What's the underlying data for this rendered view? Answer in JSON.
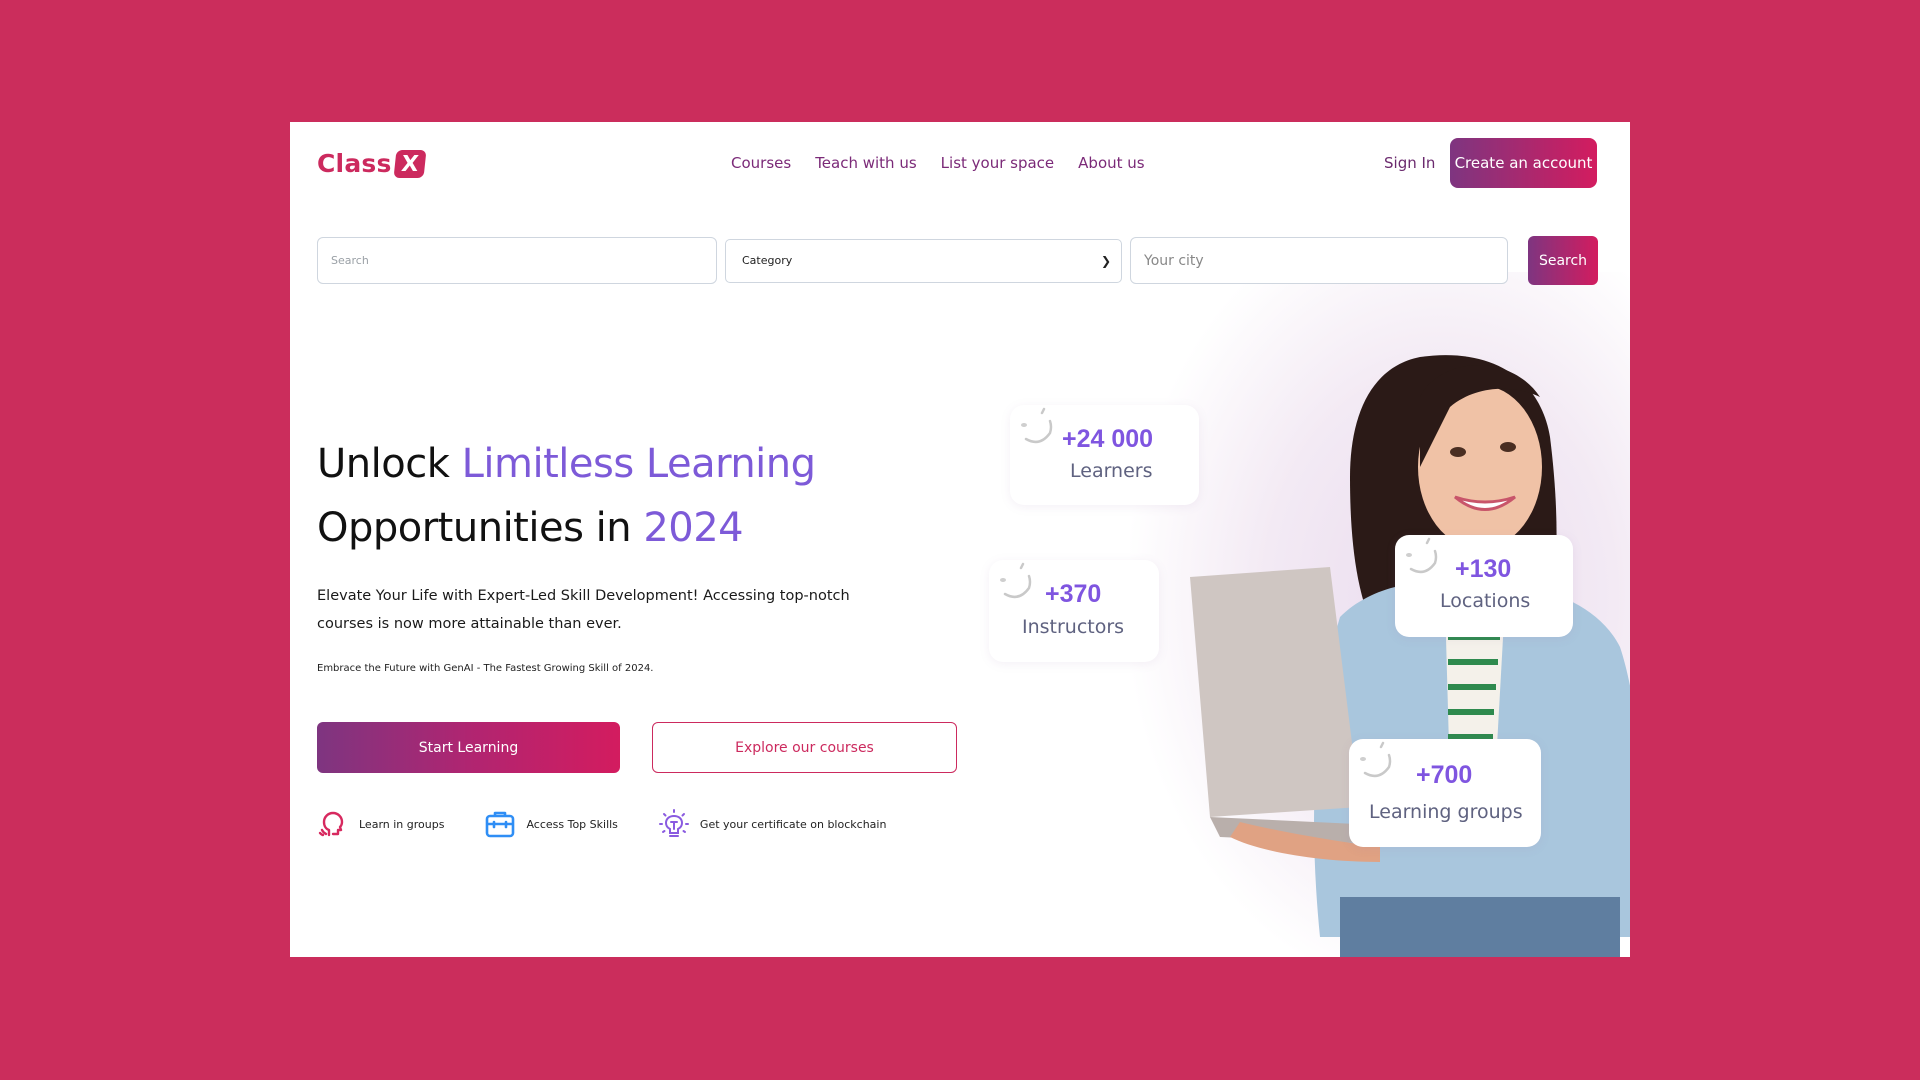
{
  "brand": {
    "name": "Class",
    "mark": "X",
    "color": "#cc2a5e"
  },
  "nav": {
    "items": [
      {
        "label": "Courses"
      },
      {
        "label": "Teach with us"
      },
      {
        "label": "List your space"
      },
      {
        "label": "About us"
      }
    ],
    "sign_in": "Sign In",
    "create_account": "Create an account"
  },
  "search": {
    "query_placeholder": "Search",
    "category_selected": "Category",
    "city_placeholder": "Your city",
    "button": "Search"
  },
  "hero": {
    "title_line1_plain": "Unlock ",
    "title_line1_accent": "Limitless Learning",
    "title_line2_plain": "Opportunities in ",
    "title_line2_accent": "2024",
    "description": "Elevate Your Life with Expert-Led Skill Development! Accessing top-notch courses is now more attainable than ever.",
    "tagline": "Embrace the Future with GenAI - The Fastest Growing Skill of 2024.",
    "primary_cta": "Start Learning",
    "secondary_cta": "Explore our courses",
    "features": [
      {
        "icon": "head-speaking-icon",
        "label": "Learn in groups"
      },
      {
        "icon": "briefcase-icon",
        "label": "Access Top Skills"
      },
      {
        "icon": "lightbulb-icon",
        "label": "Get your certificate on blockchain"
      }
    ]
  },
  "stats": [
    {
      "value": "+24 000",
      "label": "Learners"
    },
    {
      "value": "+370",
      "label": "Instructors"
    },
    {
      "value": "+130",
      "label": "Locations"
    },
    {
      "value": "+700",
      "label": "Learning groups"
    }
  ],
  "colors": {
    "page_background": "#cb2d5c",
    "accent_purple": "#7d5ad8",
    "gradient_start": "#7e3580",
    "gradient_end": "#d31c5f",
    "nav_text": "#7b2a78"
  }
}
